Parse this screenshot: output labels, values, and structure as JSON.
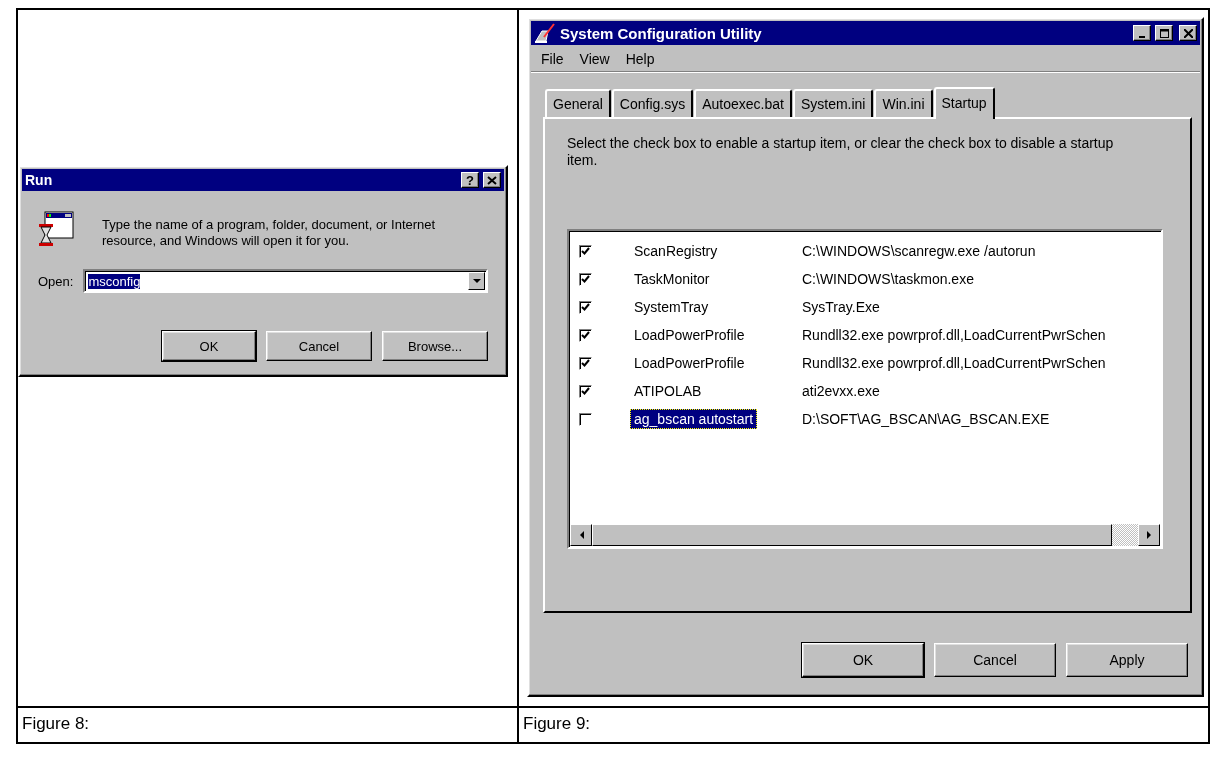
{
  "figures": [
    {
      "caption": "Figure 8:",
      "run_dialog": {
        "title": "Run",
        "help_button": "?",
        "description": "Type the name of a program, folder, document, or Internet resource, and Windows will open it for you.",
        "open_label": "Open:",
        "open_value": "msconfig",
        "value_selected": true,
        "buttons": [
          {
            "label": "OK",
            "default": true
          },
          {
            "label": "Cancel",
            "default": false
          },
          {
            "label": "Browse...",
            "default": false
          }
        ]
      }
    },
    {
      "caption": "Figure 9:",
      "config_window": {
        "title": "System Configuration Utility",
        "menu": [
          "File",
          "View",
          "Help"
        ],
        "tabs": [
          {
            "label": "General",
            "selected": false
          },
          {
            "label": "Config.sys",
            "selected": false
          },
          {
            "label": "Autoexec.bat",
            "selected": false
          },
          {
            "label": "System.ini",
            "selected": false
          },
          {
            "label": "Win.ini",
            "selected": false
          },
          {
            "label": "Startup",
            "selected": true
          }
        ],
        "instructions": "Select the check box to enable a startup item, or clear the check box to disable a startup item.",
        "items": [
          {
            "checked": true,
            "name": "ScanRegistry",
            "command": "C:\\WINDOWS\\scanregw.exe /autorun",
            "selected": false
          },
          {
            "checked": true,
            "name": "TaskMonitor",
            "command": "C:\\WINDOWS\\taskmon.exe",
            "selected": false
          },
          {
            "checked": true,
            "name": "SystemTray",
            "command": "SysTray.Exe",
            "selected": false
          },
          {
            "checked": true,
            "name": "LoadPowerProfile",
            "command": "Rundll32.exe powrprof.dll,LoadCurrentPwrSchen",
            "selected": false
          },
          {
            "checked": true,
            "name": "LoadPowerProfile",
            "command": "Rundll32.exe powrprof.dll,LoadCurrentPwrSchen",
            "selected": false
          },
          {
            "checked": true,
            "name": "ATIPOLAB",
            "command": "ati2evxx.exe",
            "selected": false
          },
          {
            "checked": false,
            "name": "ag_bscan autostart",
            "command": "D:\\SOFT\\AG_BSCAN\\AG_BSCAN.EXE",
            "selected": true
          }
        ],
        "buttons": [
          {
            "label": "OK",
            "default": true
          },
          {
            "label": "Cancel",
            "default": false
          },
          {
            "label": "Apply",
            "default": false
          }
        ]
      }
    }
  ]
}
